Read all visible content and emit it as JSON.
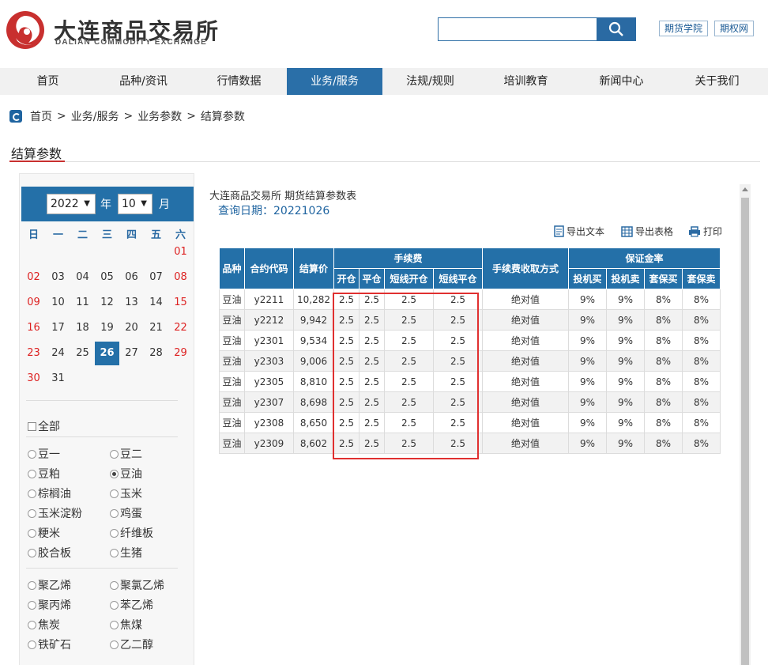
{
  "brand": {
    "name_cn": "大连商品交易所",
    "name_en": "DALIAN COMMODITY EXCHANGE",
    "colors": {
      "red": "#c8302f",
      "blue": "#2470a8"
    }
  },
  "search": {
    "placeholder": "",
    "value": "",
    "icon": "search-icon"
  },
  "top_links": [
    "期货学院",
    "期权网"
  ],
  "nav": [
    "首页",
    "品种/资讯",
    "行情数据",
    "业务/服务",
    "法规/规则",
    "培训教育",
    "新闻中心",
    "关于我们"
  ],
  "nav_active": "业务/服务",
  "breadcrumb": [
    "首页",
    "业务/服务",
    "业务参数",
    "结算参数"
  ],
  "breadcrumb_sep": ">",
  "page_title": "结算参数",
  "calendar": {
    "year": "2022",
    "year_label": "年",
    "month": "10",
    "month_label": "月",
    "weekdays": [
      "日",
      "一",
      "二",
      "三",
      "四",
      "五",
      "六"
    ],
    "selected_day": "26"
  },
  "filters": {
    "all_label": "全部",
    "group1": [
      "豆一",
      "豆二",
      "豆粕",
      "豆油",
      "棕榈油",
      "玉米",
      "玉米淀粉",
      "鸡蛋",
      "粳米",
      "纤维板",
      "胶合板",
      "生猪"
    ],
    "group2": [
      "聚乙烯",
      "聚氯乙烯",
      "聚丙烯",
      "苯乙烯",
      "焦炭",
      "焦煤",
      "铁矿石",
      "乙二醇"
    ],
    "selected": "豆油"
  },
  "report": {
    "title": "大连商品交易所 期货结算参数表",
    "query_label": "查询日期：",
    "query_date": "20221026",
    "tools": {
      "export_text": "导出文本",
      "export_table": "导出表格",
      "print": "打印"
    }
  },
  "table": {
    "headers": {
      "variety": "品种",
      "contract": "合约代码",
      "settle": "结算价",
      "fee": "手续费",
      "fee_sub": [
        "开仓",
        "平仓",
        "短线开仓",
        "短线平仓"
      ],
      "fee_mode": "手续费收取方式",
      "margin": "保证金率",
      "margin_sub": [
        "投机买",
        "投机卖",
        "套保买",
        "套保卖"
      ]
    },
    "rows": [
      [
        "豆油",
        "y2211",
        "10,282",
        "2.5",
        "2.5",
        "2.5",
        "2.5",
        "绝对值",
        "9%",
        "9%",
        "8%",
        "8%"
      ],
      [
        "豆油",
        "y2212",
        "9,942",
        "2.5",
        "2.5",
        "2.5",
        "2.5",
        "绝对值",
        "9%",
        "9%",
        "8%",
        "8%"
      ],
      [
        "豆油",
        "y2301",
        "9,534",
        "2.5",
        "2.5",
        "2.5",
        "2.5",
        "绝对值",
        "9%",
        "9%",
        "8%",
        "8%"
      ],
      [
        "豆油",
        "y2303",
        "9,006",
        "2.5",
        "2.5",
        "2.5",
        "2.5",
        "绝对值",
        "9%",
        "9%",
        "8%",
        "8%"
      ],
      [
        "豆油",
        "y2305",
        "8,810",
        "2.5",
        "2.5",
        "2.5",
        "2.5",
        "绝对值",
        "9%",
        "9%",
        "8%",
        "8%"
      ],
      [
        "豆油",
        "y2307",
        "8,698",
        "2.5",
        "2.5",
        "2.5",
        "2.5",
        "绝对值",
        "9%",
        "9%",
        "8%",
        "8%"
      ],
      [
        "豆油",
        "y2308",
        "8,650",
        "2.5",
        "2.5",
        "2.5",
        "2.5",
        "绝对值",
        "9%",
        "9%",
        "8%",
        "8%"
      ],
      [
        "豆油",
        "y2309",
        "8,602",
        "2.5",
        "2.5",
        "2.5",
        "2.5",
        "绝对值",
        "9%",
        "9%",
        "8%",
        "8%"
      ]
    ]
  }
}
